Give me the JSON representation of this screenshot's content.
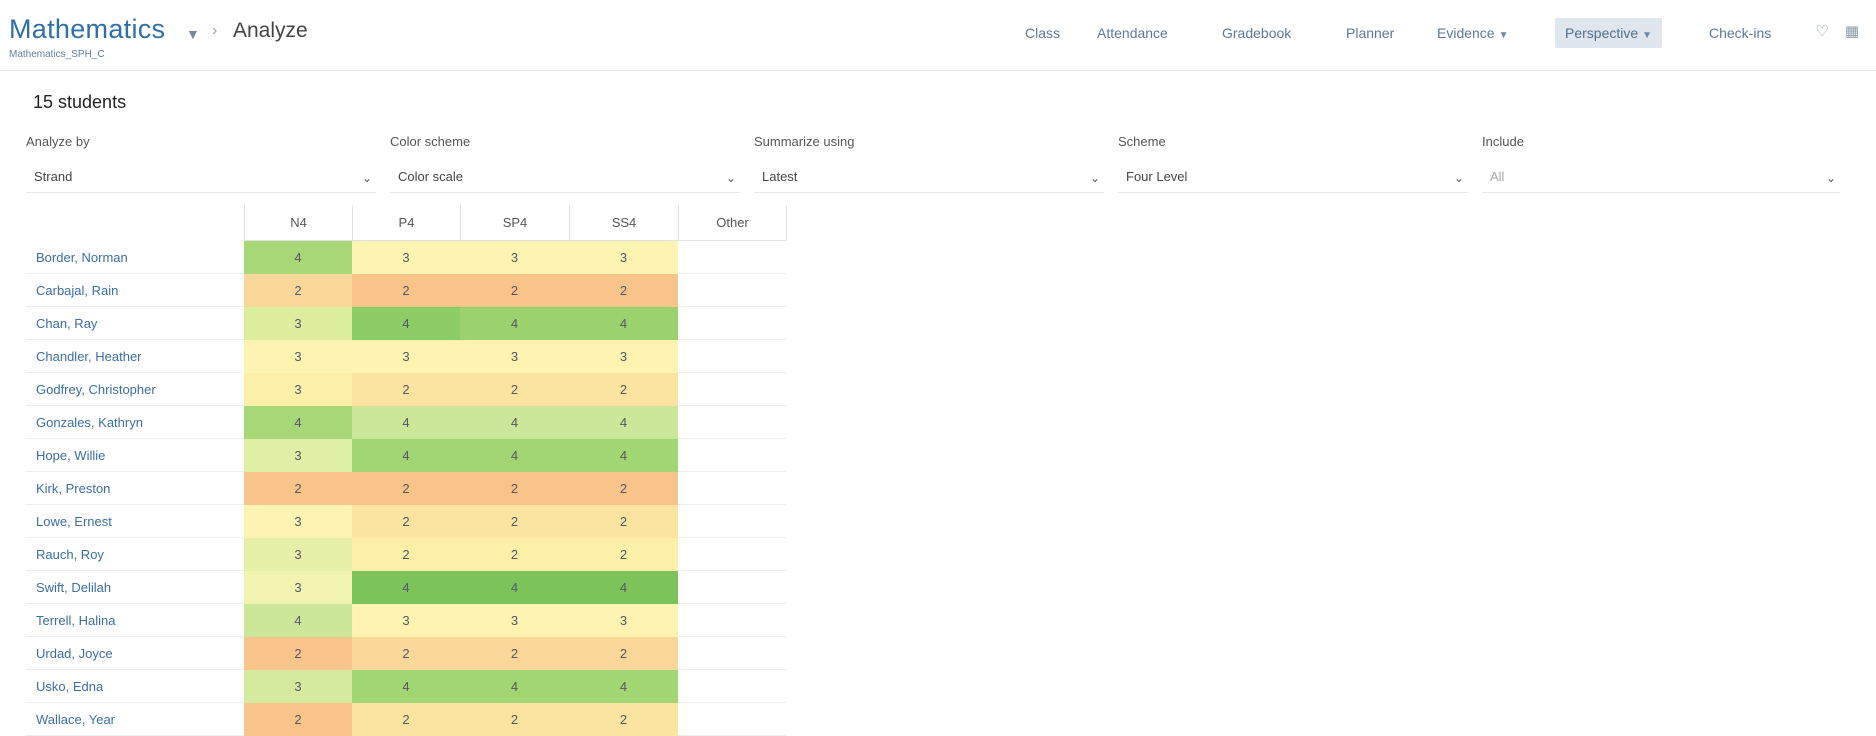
{
  "header": {
    "course_title": "Mathematics",
    "section": "Mathematics_SPH_C",
    "page": "Analyze",
    "nav": [
      {
        "label": "Class"
      },
      {
        "label": "Attendance"
      },
      {
        "label": "Gradebook"
      },
      {
        "label": "Planner"
      },
      {
        "label": "Evidence",
        "has_caret": true
      },
      {
        "label": "Perspective",
        "has_caret": true,
        "active": true
      },
      {
        "label": "Check-ins"
      }
    ],
    "icons": [
      "bell-icon",
      "grid-menu-icon"
    ]
  },
  "student_count": "15 students",
  "filters": [
    {
      "label": "Analyze by",
      "value": "Strand"
    },
    {
      "label": "Color scheme",
      "value": "Color scale"
    },
    {
      "label": "Summarize using",
      "value": "Latest"
    },
    {
      "label": "Scheme",
      "value": "Four Level"
    },
    {
      "label": "Include",
      "value": "All",
      "placeholder": true
    }
  ],
  "table": {
    "columns": [
      "N4",
      "P4",
      "SP4",
      "SS4",
      "Other"
    ],
    "rows": [
      {
        "name": "Border, Norman",
        "scores": [
          "4",
          "3",
          "3",
          "3"
        ]
      },
      {
        "name": "Carbajal, Rain",
        "scores": [
          "2",
          "2",
          "2",
          "2"
        ]
      },
      {
        "name": "Chan, Ray",
        "scores": [
          "3",
          "4",
          "4",
          "4"
        ]
      },
      {
        "name": "Chandler, Heather",
        "scores": [
          "3",
          "3",
          "3",
          "3"
        ]
      },
      {
        "name": "Godfrey, Christopher",
        "scores": [
          "3",
          "2",
          "2",
          "2"
        ]
      },
      {
        "name": "Gonzales, Kathryn",
        "scores": [
          "4",
          "4",
          "4",
          "4"
        ]
      },
      {
        "name": "Hope, Willie",
        "scores": [
          "3",
          "4",
          "4",
          "4"
        ]
      },
      {
        "name": "Kirk, Preston",
        "scores": [
          "2",
          "2",
          "2",
          "2"
        ]
      },
      {
        "name": "Lowe, Ernest",
        "scores": [
          "3",
          "2",
          "2",
          "2"
        ]
      },
      {
        "name": "Rauch, Roy",
        "scores": [
          "3",
          "2",
          "2",
          "2"
        ]
      },
      {
        "name": "Swift, Delilah",
        "scores": [
          "3",
          "4",
          "4",
          "4"
        ]
      },
      {
        "name": "Terrell, Halina",
        "scores": [
          "4",
          "3",
          "3",
          "3"
        ]
      },
      {
        "name": "Urdad, Joyce",
        "scores": [
          "2",
          "2",
          "2",
          "2"
        ]
      },
      {
        "name": "Usko, Edna",
        "scores": [
          "3",
          "4",
          "4",
          "4"
        ]
      },
      {
        "name": "Wallace, Year",
        "scores": [
          "2",
          "2",
          "2",
          "2"
        ]
      }
    ]
  },
  "colors": {
    "level_2_light": "#fbd79a",
    "level_2_strong": "#f9c489",
    "level_3": "#fcf4b0",
    "level_4_light": "#d5ea9e",
    "level_4_mid": "#b5dd86",
    "level_4_strong": "#8ccd66",
    "link": "#3a6ea5",
    "nav_active_bg": "#dfe6ee"
  },
  "cell_colors": [
    [
      "#a8d778",
      "#fcf4b0",
      "#fcf4b0",
      "#fcf4b0"
    ],
    [
      "#fbd79a",
      "#f9c489",
      "#f9c489",
      "#f9c489"
    ],
    [
      "#dcee9e",
      "#8ccd66",
      "#9cd26e",
      "#9cd26e"
    ],
    [
      "#fcf4b0",
      "#fcf4b0",
      "#fcf4b0",
      "#fcf4b0"
    ],
    [
      "#fcf0a8",
      "#fbe3a0",
      "#fbe3a0",
      "#fbe3a0"
    ],
    [
      "#a8d778",
      "#cde79a",
      "#cde79a",
      "#cde79a"
    ],
    [
      "#e0efa6",
      "#a2d672",
      "#a2d672",
      "#a2d672"
    ],
    [
      "#f9c489",
      "#f9c489",
      "#f9c489",
      "#f9c489"
    ],
    [
      "#fcf4b0",
      "#fbe3a0",
      "#fbe3a0",
      "#fbe3a0"
    ],
    [
      "#e6f0a8",
      "#fcf0a8",
      "#fcf0a8",
      "#fcf0a8"
    ],
    [
      "#f0f4b0",
      "#7cc35a",
      "#7cc35a",
      "#7cc35a"
    ],
    [
      "#cde79a",
      "#fcf4b0",
      "#fcf4b0",
      "#fcf4b0"
    ],
    [
      "#f9c489",
      "#fbd79a",
      "#fbd79a",
      "#fbd79a"
    ],
    [
      "#d5ea9e",
      "#a2d672",
      "#a2d672",
      "#a2d672"
    ],
    [
      "#f9c489",
      "#fbe3a0",
      "#fbe3a0",
      "#fbe3a0"
    ]
  ]
}
